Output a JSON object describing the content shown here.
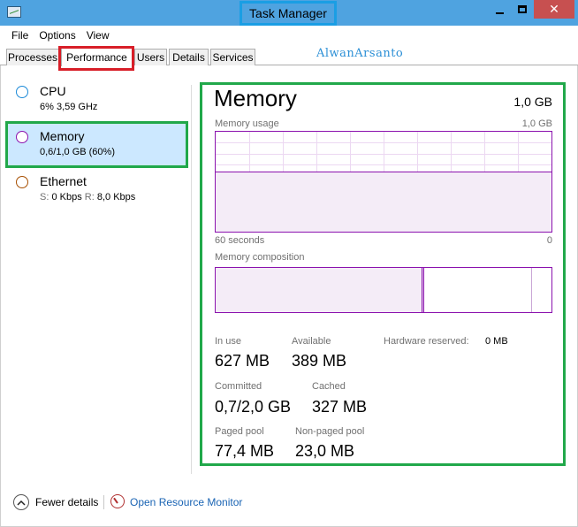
{
  "window": {
    "title": "Task Manager",
    "controls": {
      "minimize_icon": "minimize-icon",
      "maximize_icon": "maximize-icon",
      "close_glyph": "✕"
    }
  },
  "menu": {
    "items": [
      "File",
      "Options",
      "View"
    ]
  },
  "tabs": {
    "items": [
      "Processes",
      "Performance",
      "Users",
      "Details",
      "Services"
    ],
    "active": "Performance"
  },
  "watermark": "AlwanArsanto",
  "sidebar": {
    "items": [
      {
        "name": "CPU",
        "detail": "6% 3,59 GHz",
        "color": "#1c8ad8"
      },
      {
        "name": "Memory",
        "detail": "0,6/1,0 GB (60%)",
        "color": "#8b12ae",
        "selected": true
      },
      {
        "name": "Ethernet",
        "detail_s_label": "S:",
        "detail_s_value": "0 Kbps",
        "detail_r_label": "R:",
        "detail_r_value": "8,0 Kbps",
        "color": "#a74f01"
      }
    ]
  },
  "main": {
    "title": "Memory",
    "total": "1,0 GB",
    "usage_graph": {
      "label": "Memory usage",
      "max_label": "1,0 GB",
      "time_label": "60 seconds",
      "min_label": "0",
      "fill_fraction": 0.6,
      "line_color": "#8b12ae"
    },
    "composition": {
      "label": "Memory composition",
      "in_use_fraction": 0.617,
      "modified_fraction": 0.006,
      "free_start_fraction": 0.94
    },
    "stats": {
      "in_use_label": "In use",
      "in_use_value": "627 MB",
      "available_label": "Available",
      "available_value": "389 MB",
      "hw_reserved_label": "Hardware reserved:",
      "hw_reserved_value": "0 MB",
      "committed_label": "Committed",
      "committed_value": "0,7/2,0 GB",
      "cached_label": "Cached",
      "cached_value": "327 MB",
      "paged_label": "Paged pool",
      "paged_value": "77,4 MB",
      "nonpaged_label": "Non-paged pool",
      "nonpaged_value": "23,0 MB"
    }
  },
  "footer": {
    "fewer_details": "Fewer details",
    "open_resource_monitor": "Open Resource Monitor"
  },
  "annotation_colors": {
    "title": "#1a9ee4",
    "tab": "#d81e28",
    "memory": "#21a84a"
  }
}
